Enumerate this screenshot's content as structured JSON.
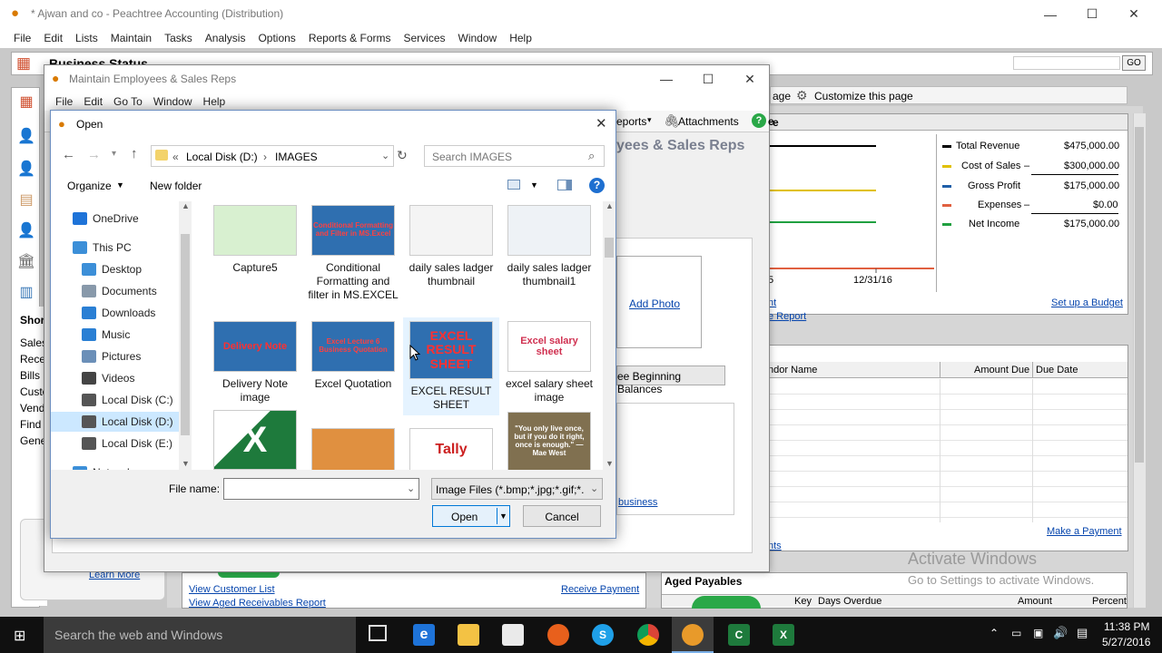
{
  "app": {
    "title": "* Ajwan and co - Peachtree Accounting (Distribution)",
    "menu": [
      "File",
      "Edit",
      "Lists",
      "Maintain",
      "Tasks",
      "Analysis",
      "Options",
      "Reports & Forms",
      "Services",
      "Window",
      "Help"
    ],
    "minimize": "—",
    "maximize": "☐",
    "close": "✕"
  },
  "business_status": {
    "title": "Business Status",
    "go": "GO",
    "toolbar_fragment": "age",
    "customize": "Customize this page",
    "shortcuts_label": "Shor",
    "shortcuts": [
      "Sales",
      "Recei",
      "Bills",
      "Custo",
      "Vend",
      "Find",
      "Gene"
    ],
    "learn_more": "Learn More"
  },
  "revenue": {
    "date_tick": "12/31/16",
    "date_tick_left": "5",
    "items": [
      {
        "label": "Total Revenue",
        "sign": "",
        "value": "$475,000.00",
        "color": "#000000"
      },
      {
        "label": "Cost of Sales",
        "sign": "–",
        "value": "$300,000.00",
        "color": "#e0c000"
      },
      {
        "label": "Gross Profit",
        "sign": "",
        "value": "$175,000.00",
        "color": "#1f5fa8"
      },
      {
        "label": "Expenses",
        "sign": "–",
        "value": "$0.00",
        "color": "#e06040"
      },
      {
        "label": "Net Income",
        "sign": "",
        "value": "$175,000.00",
        "color": "#20a040"
      }
    ],
    "link_left": "nt",
    "link_report": "e Report",
    "setup_budget": "Set up a Budget"
  },
  "vendor_table": {
    "col_name": "ndor Name",
    "col_amount": "Amount Due",
    "col_date": "Due Date",
    "make_payment": "Make a Payment",
    "link_nts": "nts"
  },
  "aged_payables": {
    "title": "Aged Payables",
    "col_key": "Key",
    "col_days": "Days Overdue",
    "col_amount": "Amount",
    "col_percent": "Percent"
  },
  "customer_links": {
    "view_list": "View Customer List",
    "view_aged": "View Aged Receivables Report",
    "receive_payment": "Receive Payment"
  },
  "employee_window": {
    "title": "Maintain Employees & Sales Reps",
    "menu": [
      "File",
      "Edit",
      "Go To",
      "Window",
      "Help"
    ],
    "reports": "eports",
    "attachments": "Attachments",
    "heading": "yees & Sales Reps",
    "tab_fragment": "e",
    "add_photo": "Add Photo",
    "beginning_balances": "ee Beginning Balances",
    "business_link": "business"
  },
  "open_dialog": {
    "title": "Open",
    "path_prefix": "«",
    "path_drive": "Local Disk (D:)",
    "path_sep": "›",
    "path_folder": "IMAGES",
    "search_placeholder": "Search IMAGES",
    "organize": "Organize",
    "new_folder": "New folder",
    "tree": [
      {
        "label": "OneDrive",
        "icon": "cloud-icon",
        "color": "#1e73d8",
        "indent": 24,
        "selected": false
      },
      {
        "label": "This PC",
        "icon": "computer-icon",
        "color": "#3c8fd8",
        "indent": 24,
        "selected": false
      },
      {
        "label": "Desktop",
        "icon": "desktop-icon",
        "color": "#3c8fd8",
        "indent": 34,
        "selected": false
      },
      {
        "label": "Documents",
        "icon": "documents-icon",
        "color": "#8899aa",
        "indent": 34,
        "selected": false
      },
      {
        "label": "Downloads",
        "icon": "downloads-icon",
        "color": "#2a7fd4",
        "indent": 34,
        "selected": false
      },
      {
        "label": "Music",
        "icon": "music-icon",
        "color": "#2a7fd4",
        "indent": 34,
        "selected": false
      },
      {
        "label": "Pictures",
        "icon": "pictures-icon",
        "color": "#6b8fb8",
        "indent": 34,
        "selected": false
      },
      {
        "label": "Videos",
        "icon": "videos-icon",
        "color": "#444444",
        "indent": 34,
        "selected": false
      },
      {
        "label": "Local Disk (C:)",
        "icon": "disk-c-icon",
        "color": "#555555",
        "indent": 34,
        "selected": false
      },
      {
        "label": "Local Disk (D:)",
        "icon": "disk-d-icon",
        "color": "#555555",
        "indent": 34,
        "selected": true
      },
      {
        "label": "Local Disk (E:)",
        "icon": "disk-e-icon",
        "color": "#555555",
        "indent": 34,
        "selected": false
      },
      {
        "label": "Network",
        "icon": "network-icon",
        "color": "#3c8fd8",
        "indent": 24,
        "selected": false
      }
    ],
    "files": [
      {
        "label": "Capture5",
        "thumb_text": "",
        "bg": "#d8f0d0",
        "fg": "#333333"
      },
      {
        "label": "Conditional Formatting and filter in MS.EXCEL",
        "thumb_text": "Conditional Formatting and Filter in MS.Excel",
        "bg": "#2f6fb0",
        "fg": "#ff4040"
      },
      {
        "label": "daily sales ladger thumbnail",
        "thumb_text": "",
        "bg": "#f4f4f4",
        "fg": "#333333"
      },
      {
        "label": "daily sales ladger thumbnail1",
        "thumb_text": "",
        "bg": "#eef2f6",
        "fg": "#333333"
      },
      {
        "label": "Delivery Note image",
        "thumb_text": "Delivery Note",
        "bg": "#2f6fb0",
        "fg": "#ff3030"
      },
      {
        "label": "Excel Quotation",
        "thumb_text": "Excel Lecture 6 Business Quotation",
        "bg": "#2f6fb0",
        "fg": "#ff4040"
      },
      {
        "label": "EXCEL RESULT SHEET",
        "thumb_text": "EXCEL RESULT SHEET",
        "bg": "#2f6fb0",
        "fg": "#ff3030"
      },
      {
        "label": "excel salary sheet image",
        "thumb_text": "Excel salary sheet",
        "bg": "#ffffff",
        "fg": "#d03050"
      },
      {
        "label": "",
        "thumb_text": "X",
        "bg": "#1e7a3c",
        "fg": "#ffffff"
      },
      {
        "label": "",
        "thumb_text": "",
        "bg": "#e09040",
        "fg": "#ffffff"
      },
      {
        "label": "",
        "thumb_text": "Tally",
        "bg": "#ffffff",
        "fg": "#cc2020"
      },
      {
        "label": "",
        "thumb_text": "\"You only live once, but if you do it right, once is enough.\" — Mae West",
        "bg": "#807050",
        "fg": "#ffffff"
      }
    ],
    "file_name_label": "File name:",
    "file_name_value": "",
    "file_type": "Image Files (*.bmp;*.jpg;*.gif;*.",
    "open_button": "Open",
    "cancel_button": "Cancel"
  },
  "watermark": {
    "line1": "Activate Windows",
    "line2": "Go to Settings to activate Windows."
  },
  "taskbar": {
    "search_placeholder": "Search the web and Windows",
    "time": "11:38 PM",
    "date": "5/27/2016"
  }
}
